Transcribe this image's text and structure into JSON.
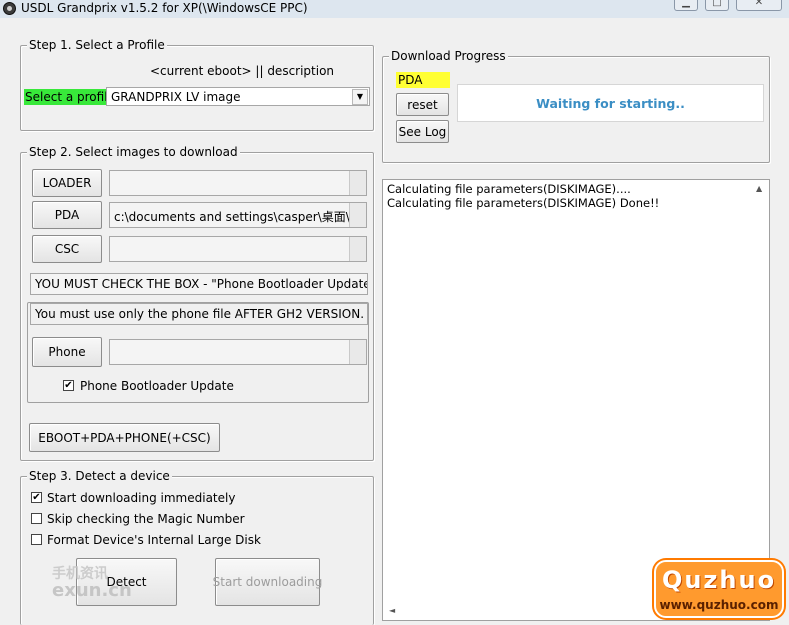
{
  "window": {
    "title": "USDL Grandprix v1.5.2 for XP(\\WindowsCE PPC)"
  },
  "step1": {
    "title": "Step 1. Select a Profile",
    "column_header": "<current eboot> || description",
    "select_label": "Select a profile",
    "selected_profile": "GRANDPRIX LV image"
  },
  "step2": {
    "title": "Step 2. Select images to download",
    "loader_label": "LOADER",
    "loader_path": "",
    "pda_label": "PDA",
    "pda_path": "c:\\documents and settings\\casper\\桌面\\g",
    "csc_label": "CSC",
    "csc_path": "",
    "warning_check_box": "YOU MUST CHECK THE BOX  -  \"Phone Bootloader Update\"",
    "warning_version": "You must use only the phone file AFTER  GH2 VERSION.",
    "phone_label": "Phone",
    "phone_path": "",
    "bootloader_update_label": "Phone Bootloader Update",
    "combo_button_label": "EBOOT+PDA+PHONE(+CSC)"
  },
  "step3": {
    "title": "Step 3. Detect a device",
    "options": [
      {
        "label": "Start downloading immediately",
        "checked": true
      },
      {
        "label": "Skip checking the Magic Number",
        "checked": false
      },
      {
        "label": "Format Device's Internal Large Disk",
        "checked": false
      }
    ],
    "detect_label": "Detect",
    "start_label": "Start downloading"
  },
  "progress": {
    "title": "Download Progress",
    "target_label": "PDA",
    "reset_label": "reset",
    "see_log_label": "See Log",
    "status_text": "Waiting for starting..",
    "status_color": "#3b8ec4"
  },
  "log": {
    "lines": [
      "Calculating file parameters(DISKIMAGE)....",
      "Calculating file parameters(DISKIMAGE) Done!!"
    ]
  },
  "watermarks": {
    "left_top": "手机资讯",
    "left_bottom": "exun.cn",
    "right_brand": "Quzhuo",
    "right_url": "www.quzhuo.com"
  },
  "colors": {
    "select_label_bg": "#38e83a",
    "pda_label_bg": "#ffff33"
  },
  "icons": {
    "app": "app-icon",
    "minimize": "minimize-icon",
    "maximize": "maximize-icon",
    "close": "close-icon",
    "dropdown": "chevron-down-icon"
  }
}
